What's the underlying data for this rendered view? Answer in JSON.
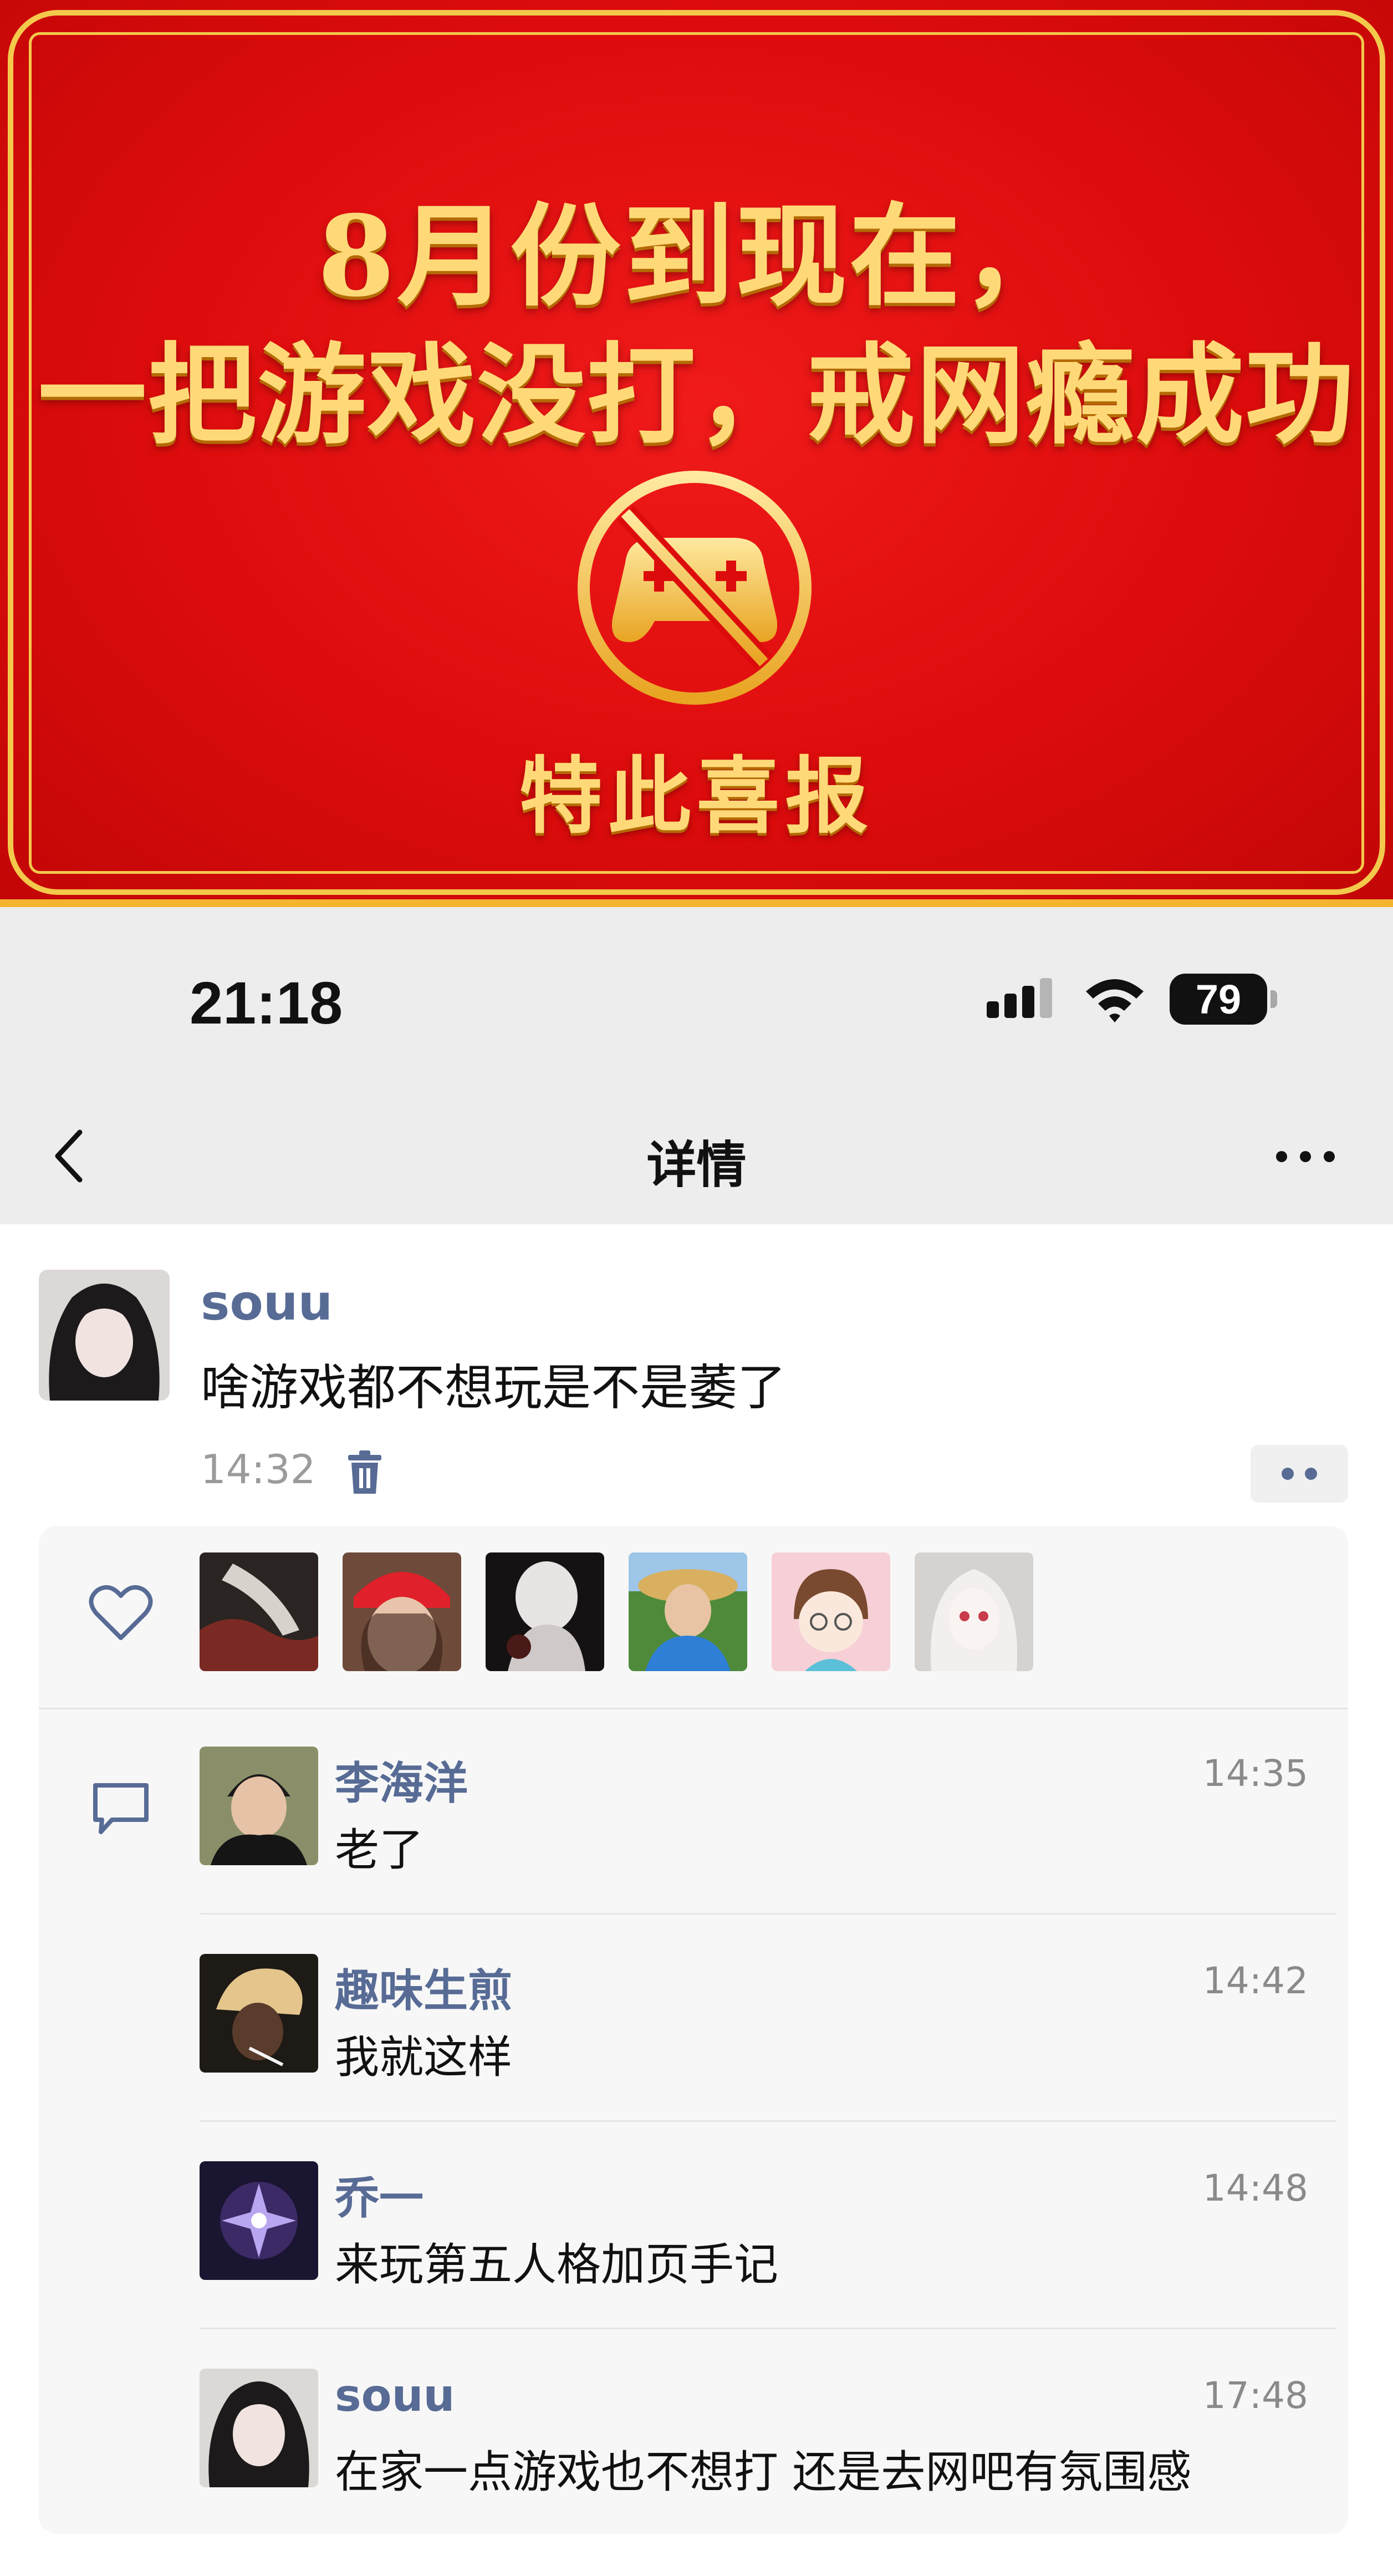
{
  "banner": {
    "line1": "8月份到现在，",
    "line2": "一把游戏没打，戒网瘾成功",
    "icon": "no-gamepad-icon",
    "footer": "特此喜报",
    "colors": {
      "background": "#dd0c0c",
      "gold": "#ffd978"
    }
  },
  "status_bar": {
    "time": "21:18",
    "battery": "79"
  },
  "nav": {
    "title": "详情",
    "back_icon": "chevron-left-icon",
    "more_icon": "ellipsis-icon"
  },
  "post": {
    "author": "souu",
    "text": "啥游戏都不想玩是不是萎了",
    "time": "14:32",
    "delete_icon": "trash-icon",
    "more_icon": "two-dots-icon"
  },
  "likes": {
    "icon": "heart-icon",
    "avatars": [
      "avatar-1",
      "avatar-2",
      "avatar-3",
      "avatar-4",
      "avatar-5",
      "avatar-6"
    ]
  },
  "comments": {
    "icon": "comment-icon",
    "items": [
      {
        "author": "李海洋",
        "time": "14:35",
        "text": "老了"
      },
      {
        "author": "趣味生煎",
        "time": "14:42",
        "text": "我就这样"
      },
      {
        "author": "乔一",
        "time": "14:48",
        "text": "来玩第五人格加页手记"
      },
      {
        "author": "souu",
        "time": "17:48",
        "text": "在家一点游戏也不想打 还是去网吧有氛围感"
      }
    ]
  },
  "colors": {
    "link": "#576b95",
    "panel_bg": "#f7f7f7",
    "header_bg": "#ededed"
  }
}
